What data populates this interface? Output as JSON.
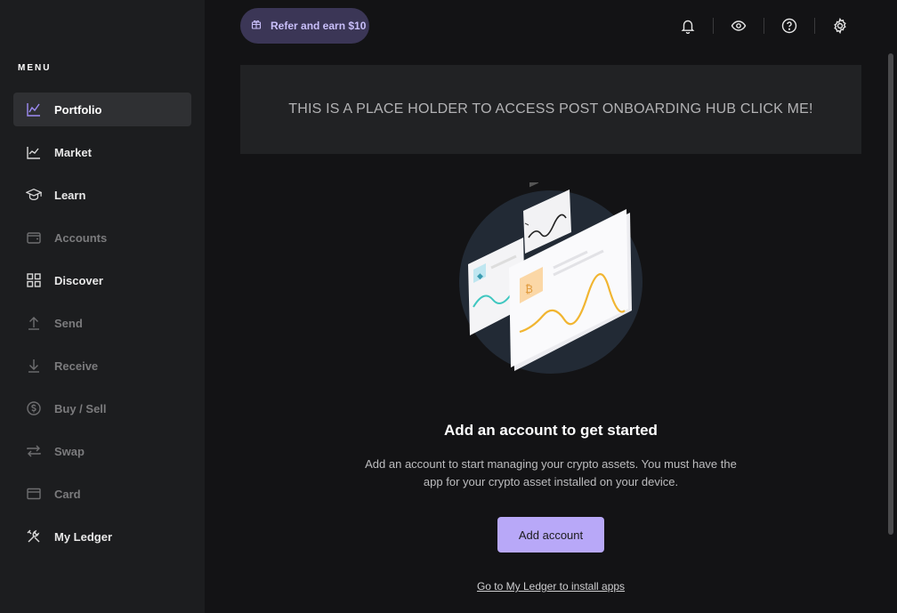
{
  "sidebar": {
    "menu_label": "MENU",
    "items": [
      {
        "label": "Portfolio",
        "icon": "chart-line-icon",
        "active": true,
        "enabled": true
      },
      {
        "label": "Market",
        "icon": "trend-chart-icon",
        "active": false,
        "enabled": true
      },
      {
        "label": "Learn",
        "icon": "graduation-cap-icon",
        "active": false,
        "enabled": true
      },
      {
        "label": "Accounts",
        "icon": "wallet-icon",
        "active": false,
        "enabled": false
      },
      {
        "label": "Discover",
        "icon": "grid-icon",
        "active": false,
        "enabled": true
      },
      {
        "label": "Send",
        "icon": "arrow-up-icon",
        "active": false,
        "enabled": false
      },
      {
        "label": "Receive",
        "icon": "arrow-down-icon",
        "active": false,
        "enabled": false
      },
      {
        "label": "Buy / Sell",
        "icon": "dollar-circle-icon",
        "active": false,
        "enabled": false
      },
      {
        "label": "Swap",
        "icon": "swap-arrows-icon",
        "active": false,
        "enabled": false
      },
      {
        "label": "Card",
        "icon": "credit-card-icon",
        "active": false,
        "enabled": false
      },
      {
        "label": "My Ledger",
        "icon": "tools-icon",
        "active": false,
        "enabled": true
      }
    ]
  },
  "topbar": {
    "refer_label": "Refer and earn $10",
    "icons": [
      "bell-icon",
      "eye-icon",
      "help-icon",
      "settings-icon"
    ]
  },
  "banner": {
    "text": "THIS IS A PLACE HOLDER TO ACCESS POST ONBOARDING HUB CLICK ME!"
  },
  "empty_state": {
    "title": "Add an account to get started",
    "description": "Add an account to start managing your crypto assets. You must have the app for your crypto asset installed on your device.",
    "button_label": "Add account",
    "link_label": "Go to My Ledger to install apps"
  },
  "colors": {
    "accent": "#b8a8f8",
    "refer_bg": "#3b3656",
    "sidebar_bg": "#1c1d1f",
    "main_bg": "#131315"
  }
}
